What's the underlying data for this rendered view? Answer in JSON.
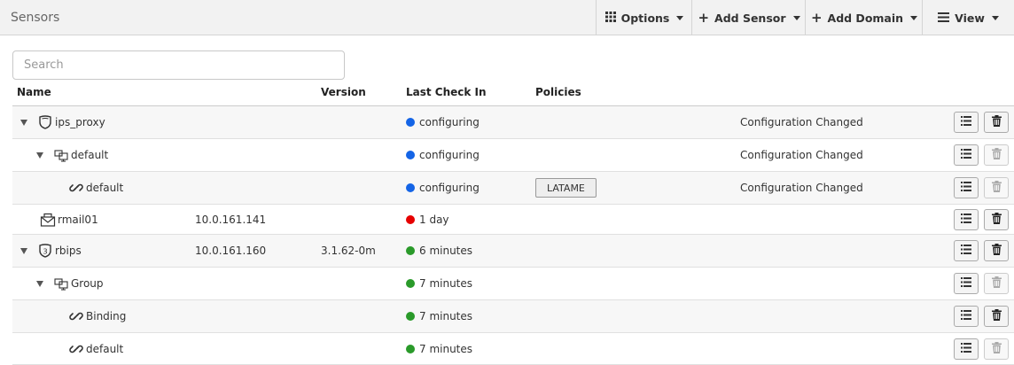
{
  "header": {
    "title": "Sensors",
    "options_label": "Options",
    "add_sensor_label": "Add Sensor",
    "add_domain_label": "Add Domain",
    "view_label": "View"
  },
  "search": {
    "placeholder": "Search",
    "value": ""
  },
  "table": {
    "columns": {
      "name": "Name",
      "version": "Version",
      "last_check_in": "Last Check In",
      "policies": "Policies"
    },
    "rows": [
      {
        "name": "ips_proxy",
        "ip": "",
        "version": "",
        "status_color": "#1464e6",
        "status": "configuring",
        "policy": "",
        "info": "Configuration Changed",
        "icon": "shield-icon",
        "delete_enabled": true
      },
      {
        "name": "default",
        "ip": "",
        "version": "",
        "status_color": "#1464e6",
        "status": "configuring",
        "policy": "",
        "info": "Configuration Changed",
        "icon": "group-icon",
        "delete_enabled": false
      },
      {
        "name": "default",
        "ip": "",
        "version": "",
        "status_color": "#1464e6",
        "status": "configuring",
        "policy": "LATAME",
        "info": "Configuration Changed",
        "icon": "link-icon",
        "delete_enabled": false
      },
      {
        "name": "rmail01",
        "ip": "10.0.161.141",
        "version": "",
        "status_color": "#e60000",
        "status": "1 day",
        "policy": "",
        "info": "",
        "icon": "mail-icon",
        "delete_enabled": true
      },
      {
        "name": "rbips",
        "ip": "10.0.161.160",
        "version": "3.1.62-0m",
        "status_color": "#2a9a2a",
        "status": "6 minutes",
        "policy": "",
        "info": "",
        "icon": "shield-3-icon",
        "delete_enabled": true
      },
      {
        "name": "Group",
        "ip": "",
        "version": "",
        "status_color": "#2a9a2a",
        "status": "7 minutes",
        "policy": "",
        "info": "",
        "icon": "group-icon",
        "delete_enabled": false
      },
      {
        "name": "Binding",
        "ip": "",
        "version": "",
        "status_color": "#2a9a2a",
        "status": "7 minutes",
        "policy": "",
        "info": "",
        "icon": "link-icon",
        "delete_enabled": true
      },
      {
        "name": "default",
        "ip": "",
        "version": "",
        "status_color": "#2a9a2a",
        "status": "7 minutes",
        "policy": "",
        "info": "",
        "icon": "link-icon",
        "delete_enabled": false
      }
    ]
  }
}
